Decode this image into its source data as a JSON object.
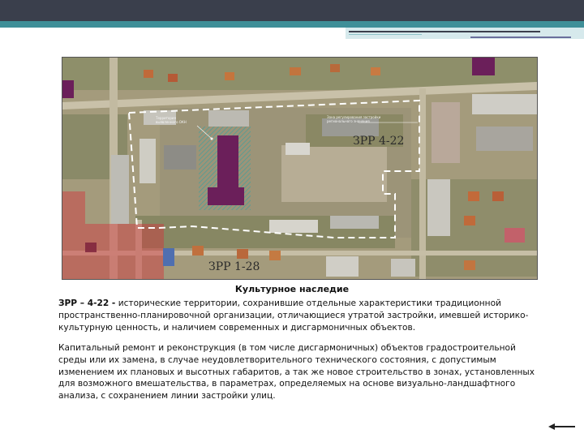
{
  "map": {
    "zone_label_main": "ЗРР 4-22",
    "zone_label_secondary": "ЗРР 1-28",
    "tiny_label_left_1": "Территория",
    "tiny_label_left_2": "выявленного ОКН",
    "tiny_label_right_1": "Зона регулирования застройки",
    "tiny_label_right_2": "регионального значения"
  },
  "caption": "Культурное наследие",
  "paragraph1": {
    "code": "ЗРР – 4-22 -",
    "text": " исторические территории, сохранившие отдельные характеристики традиционной пространственно-планировочной организации, отличающиеся утратой застройки, имевшей историко-культурную ценность, и наличием современных и дисгармоничных объектов."
  },
  "paragraph2": "Капитальный ремонт и реконструкция (в том числе дисгармоничных) объектов градостроительной среды или их замена, в случае неудовлетворительного технического состояния, с допустимым изменением их плановых и высотных габаритов, а так же новое строительство в зонах, установленных для возможного вмешательства, в параметрах, определяемых на основе визуально-ландшафтного анализа, с сохранением линии застройки улиц.",
  "nav": {
    "arrow_icon": "arrow-left-icon"
  },
  "colors": {
    "header_dark": "#3a3f4c",
    "header_teal": "#3f8f98",
    "zone_red": "#d2323c",
    "zone_purple": "#6b1f5a",
    "boundary": "#ffffff"
  }
}
